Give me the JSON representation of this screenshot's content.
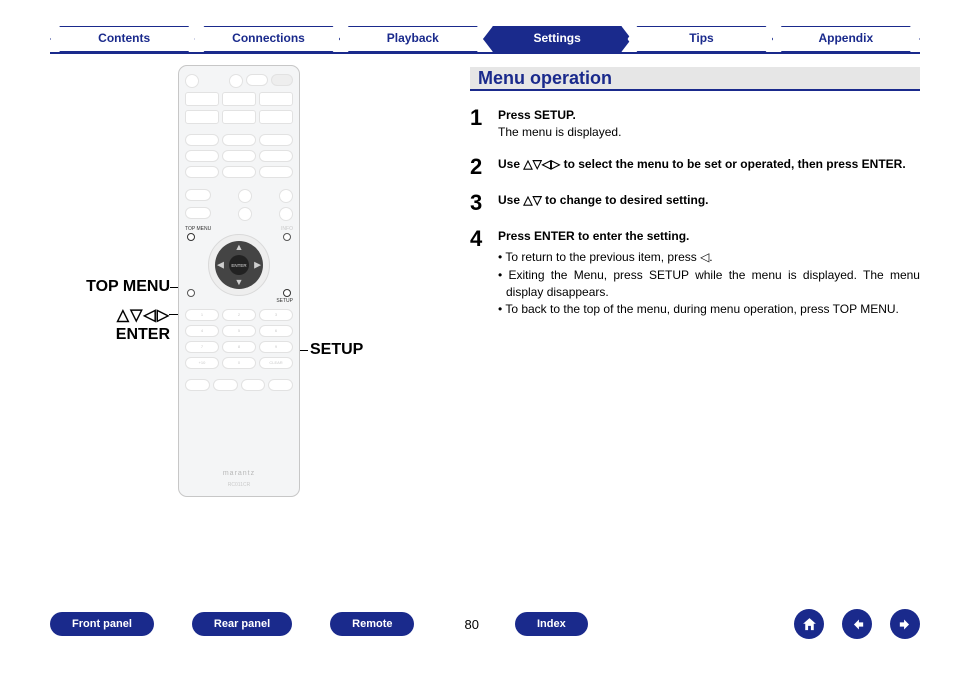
{
  "topnav": {
    "tabs": [
      {
        "label": "Contents",
        "active": false
      },
      {
        "label": "Connections",
        "active": false
      },
      {
        "label": "Playback",
        "active": false
      },
      {
        "label": "Settings",
        "active": true
      },
      {
        "label": "Tips",
        "active": false
      },
      {
        "label": "Appendix",
        "active": false
      }
    ]
  },
  "section_title": "Menu operation",
  "steps": [
    {
      "num": "1",
      "bold": "Press SETUP.",
      "text": "The menu is displayed."
    },
    {
      "num": "2",
      "bold": "Use △▽◁▷ to select the menu to be set or operated, then press ENTER."
    },
    {
      "num": "3",
      "bold": "Use △▽ to change to desired setting."
    },
    {
      "num": "4",
      "bold": "Press ENTER to enter the setting.",
      "bullets": [
        "To return to the previous item, press ◁.",
        "Exiting the Menu, press SETUP while the menu is displayed. The menu display disappears.",
        "To back to the top of the menu, during menu operation, press TOP MENU."
      ]
    }
  ],
  "callouts": {
    "top_menu": "TOP MENU",
    "arrows": "△▽◁▷",
    "enter": "ENTER",
    "setup": "SETUP"
  },
  "remote": {
    "topmenu_label": "TOP MENU",
    "info_label": "INFO",
    "setup_label": "SETUP",
    "enter_label": "ENTER",
    "brand": "marantz",
    "model": "RC011CR",
    "numpad": [
      "1",
      "2",
      "3",
      "4",
      "5",
      "6",
      "7",
      "8",
      "9",
      "+10",
      "0",
      "CLEAR"
    ]
  },
  "footer": {
    "buttons": [
      "Front panel",
      "Rear panel",
      "Remote"
    ],
    "page": "80",
    "index_btn": "Index"
  },
  "colors": {
    "brand_blue": "#1a2a8c",
    "header_grey": "#e6e6e6"
  }
}
